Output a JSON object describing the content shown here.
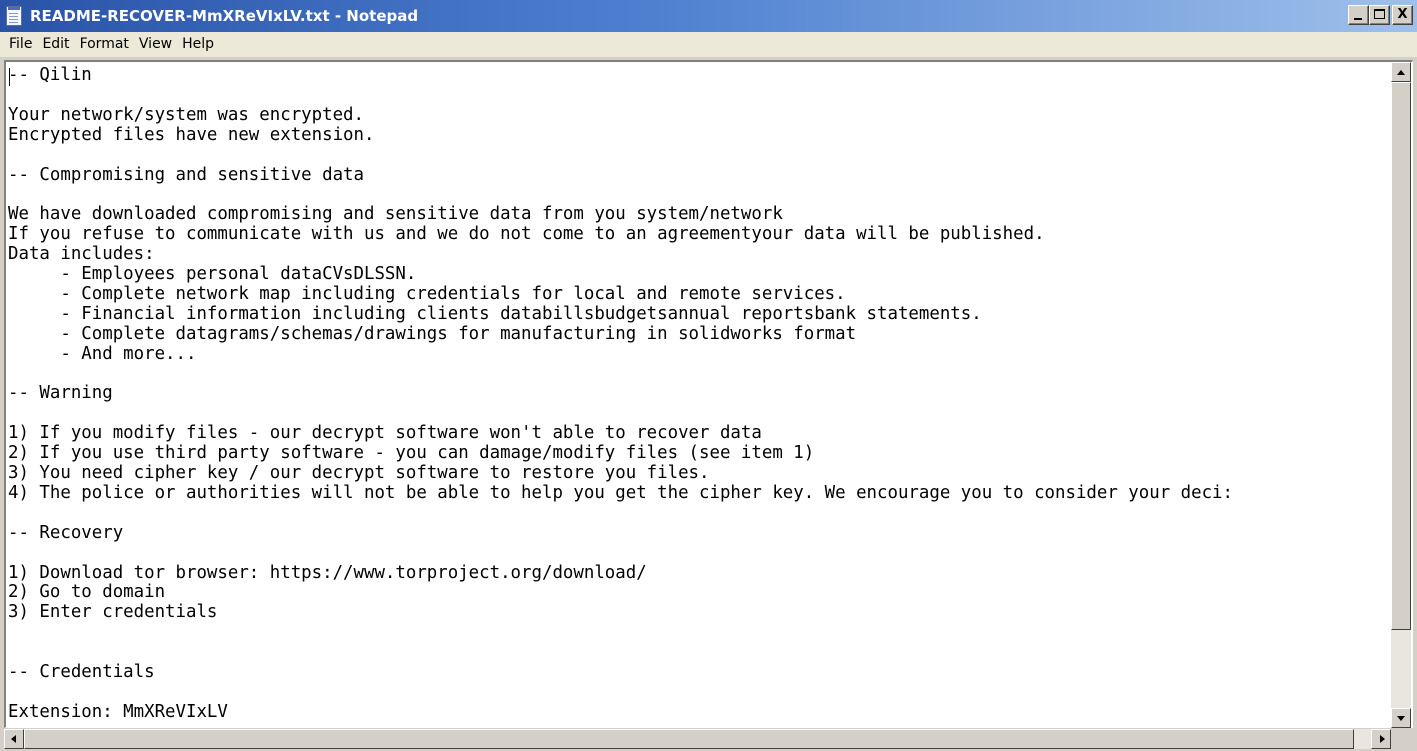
{
  "window": {
    "title": "README-RECOVER-MmXReVIxLV.txt - Notepad",
    "minimize_icon": "minimize-icon",
    "maximize_icon": "maximize-icon",
    "close_glyph": "X"
  },
  "menu": {
    "items": [
      "File",
      "Edit",
      "Format",
      "View",
      "Help"
    ]
  },
  "document": {
    "lines": [
      "-- Qilin",
      "",
      "Your network/system was encrypted.",
      "Encrypted files have new extension.",
      "",
      "-- Compromising and sensitive data",
      "",
      "We have downloaded compromising and sensitive data from you system/network",
      "If you refuse to communicate with us and we do not come to an agreementyour data will be published.",
      "Data includes:",
      "     - Employees personal dataCVsDLSSN.",
      "     - Complete network map including credentials for local and remote services.",
      "     - Financial information including clients databillsbudgetsannual reportsbank statements.",
      "     - Complete datagrams/schemas/drawings for manufacturing in solidworks format",
      "     - And more...",
      "",
      "-- Warning",
      "",
      "1) If you modify files - our decrypt software won't able to recover data",
      "2) If you use third party software - you can damage/modify files (see item 1)",
      "3) You need cipher key / our decrypt software to restore you files.",
      "4) The police or authorities will not be able to help you get the cipher key. We encourage you to consider your deci:",
      "",
      "-- Recovery",
      "",
      "1) Download tor browser: https://www.torproject.org/download/",
      "2) Go to domain",
      "3) Enter credentials",
      "",
      "",
      "-- Credentials",
      "",
      "Extension: MmXReVIxLV"
    ]
  },
  "icons": {
    "app": "notepad-icon",
    "scroll_up": "arrow-up-icon",
    "scroll_down": "arrow-down-icon",
    "scroll_left": "arrow-left-icon",
    "scroll_right": "arrow-right-icon"
  },
  "colors": {
    "titlebar_start": "#2a53a8",
    "titlebar_end": "#9fc0ea",
    "chrome": "#d4d0c8",
    "menubar": "#ece9d8",
    "editor_bg": "#ffffff",
    "text": "#000000"
  }
}
